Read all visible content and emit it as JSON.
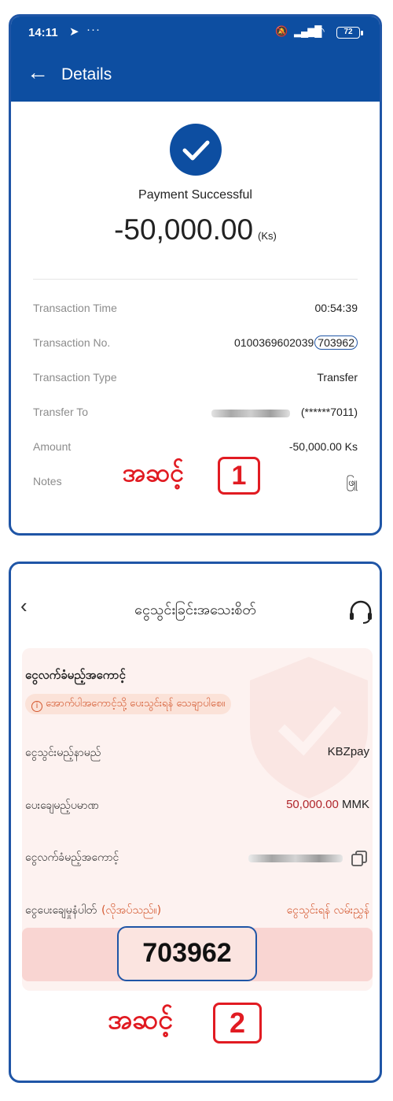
{
  "colors": {
    "brand_blue": "#0d4ea1",
    "step_red": "#e11b22",
    "warn_orange": "#d4582f"
  },
  "panel1": {
    "status_bar": {
      "time": "14:11",
      "send_icon": "send-icon",
      "dots": "···",
      "battery": "72"
    },
    "app_bar": {
      "back_icon": "arrow-left-icon",
      "title": "Details"
    },
    "status_text": "Payment Successful",
    "amount": "-50,000.00",
    "currency": "(Ks)",
    "rows": [
      {
        "label": "Transaction Time",
        "value": "00:54:39"
      },
      {
        "label": "Transaction No.",
        "value_prefix": "0100369602039",
        "value_highlight": "703962"
      },
      {
        "label": "Transaction Type",
        "value": "Transfer"
      },
      {
        "label": "Transfer To",
        "value": "(******7011)"
      },
      {
        "label": "Amount",
        "value": "-50,000.00 Ks"
      },
      {
        "label": "Notes",
        "value": "ဖြူ"
      }
    ],
    "step_label": "အဆင့်",
    "step_number": "1"
  },
  "panel2": {
    "back_icon": "chevron-left-icon",
    "title": "ငွေသွင်းခြင်းအသေးစိတ်",
    "support_icon": "headset-icon",
    "section_title": "ငွေလက်ခံမည့်အကောင့်",
    "warning": "အောက်ပါအကောင့်သို့ ပေးသွင်းရန် သေချာပါစေ။",
    "rows": [
      {
        "label": "ငွေသွင်းမည့်နာမည်",
        "value": "KBZpay"
      },
      {
        "label": "ပေးချေမည့်ပမာဏ",
        "amount": "50,000.00",
        "unit": "MMK"
      },
      {
        "label": "ငွေလက်ခံမည့်အကောင့်",
        "copy_icon": "copy-icon"
      }
    ],
    "notes_label": "ငွေပေးချေမှုနံပါတ်",
    "notes_required": "(လိုအပ်သည်။)",
    "notes_guide": "ငွေသွင်းရန် လမ်းညွှန်",
    "code": "703962",
    "step_label": "အဆင့်",
    "step_number": "2"
  }
}
